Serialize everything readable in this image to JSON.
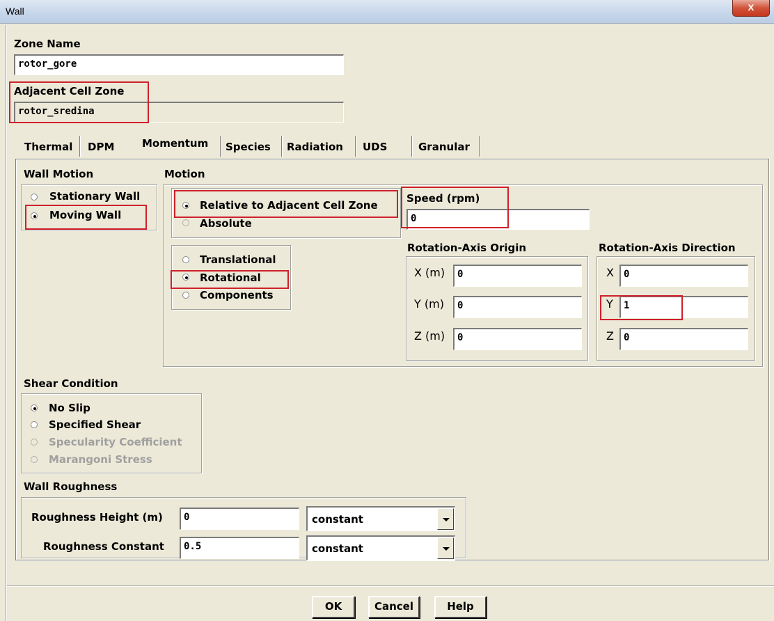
{
  "window": {
    "title": "Wall",
    "close_label": "x"
  },
  "zone_name": {
    "label": "Zone Name",
    "value": "rotor_gore"
  },
  "adjacent_cell_zone": {
    "label": "Adjacent Cell Zone",
    "value": "rotor_sredina"
  },
  "tabs": [
    "Thermal",
    "DPM",
    "Momentum",
    "Species",
    "Radiation",
    "UDS",
    "Granular"
  ],
  "active_tab": "Momentum",
  "wall_motion": {
    "label": "Wall Motion",
    "options": [
      "Stationary Wall",
      "Moving Wall"
    ],
    "selected": "Moving Wall"
  },
  "motion": {
    "label": "Motion",
    "reference_options": [
      "Relative to Adjacent Cell Zone",
      "Absolute"
    ],
    "reference_selected": "Relative to Adjacent Cell Zone",
    "type_options": [
      "Translational",
      "Rotational",
      "Components"
    ],
    "type_selected": "Rotational"
  },
  "speed": {
    "label": "Speed (rpm)",
    "value": "0"
  },
  "rotation_axis_origin": {
    "label": "Rotation-Axis Origin",
    "x_label": "X (m)",
    "x_value": "0",
    "y_label": "Y (m)",
    "y_value": "0",
    "z_label": "Z (m)",
    "z_value": "0"
  },
  "rotation_axis_direction": {
    "label": "Rotation-Axis Direction",
    "x_label": "X",
    "x_value": "0",
    "y_label": "Y",
    "y_value": "1",
    "z_label": "Z",
    "z_value": "0"
  },
  "shear_condition": {
    "label": "Shear Condition",
    "options": [
      "No Slip",
      "Specified Shear",
      "Specularity Coefficient",
      "Marangoni Stress"
    ],
    "selected": "No Slip",
    "disabled": [
      "Specularity Coefficient",
      "Marangoni Stress"
    ]
  },
  "wall_roughness": {
    "label": "Wall Roughness",
    "height_label": "Roughness Height (m)",
    "height_value": "0",
    "height_method": "constant",
    "constant_label": "Roughness Constant",
    "constant_value": "0.5",
    "constant_method": "constant"
  },
  "buttons": {
    "ok": "OK",
    "cancel": "Cancel",
    "help": "Help"
  },
  "colors": {
    "dialog_bg": "#ece9d8",
    "annotation_red": "#d0202a",
    "close_red": "#c3381e"
  }
}
